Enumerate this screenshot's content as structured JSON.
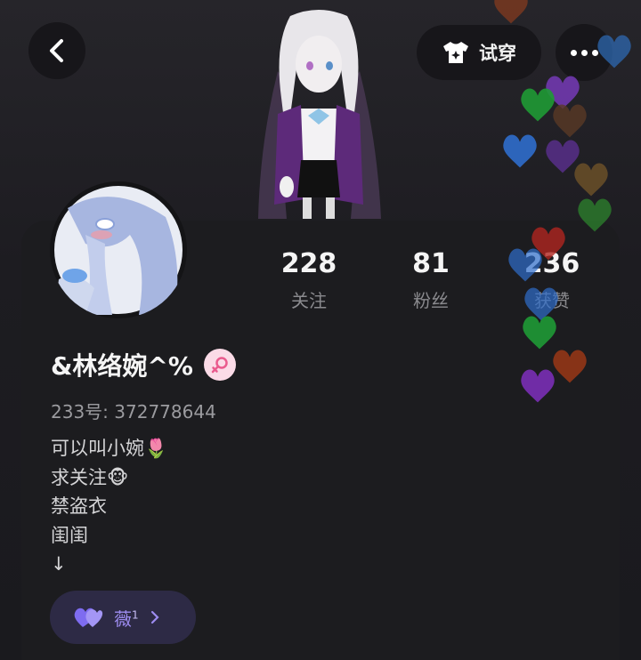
{
  "header": {
    "tryon_label": "试穿",
    "back_icon": "chevron-left-icon",
    "tryon_icon": "tshirt-icon",
    "more_icon": "more-dots-icon"
  },
  "stats": [
    {
      "value": "228",
      "label": "关注"
    },
    {
      "value": "81",
      "label": "粉丝"
    },
    {
      "value": "236",
      "label": "获赞"
    }
  ],
  "profile": {
    "name": "&林络婉^%",
    "gender_icon": "female-icon",
    "uid": "233号: 372778644",
    "bio": [
      "可以叫小婉🌷",
      "求关注🐵",
      "禁盗衣",
      "闺闺",
      "↓"
    ]
  },
  "badge": {
    "name": "薇",
    "level": "1",
    "icon": "heart-icon"
  },
  "colors": {
    "accent_purple": "#9d8cf0",
    "gender_pink": "#fbdbe7"
  }
}
